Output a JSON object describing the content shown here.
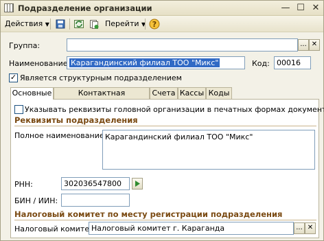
{
  "window": {
    "title": "Подразделение организации",
    "app_icon": "grid-icon",
    "controls": [
      "minimize-icon",
      "maximize-icon",
      "close-icon"
    ]
  },
  "toolbar": {
    "actions_label": "Действия",
    "goto_label": "Перейти",
    "icons": [
      "save-icon",
      "refresh-icon",
      "copy-icon",
      "help-icon"
    ]
  },
  "form": {
    "group_label": "Группа:",
    "group_value": "",
    "name_label": "Наименование:",
    "name_value": "Карагандинский филиал ТОО \"Микс\"",
    "code_label": "Код:",
    "code_value": "00016",
    "structural_label": "Является структурным подразделением",
    "structural_checked": true
  },
  "tabs": [
    "Основные",
    "Контактная информация",
    "Счета",
    "Кассы",
    "Коды"
  ],
  "main": {
    "head_org_label": "Указывать реквизиты головной организации в печатных формах документов",
    "head_org_checked": false,
    "section1_title": "Реквизиты подразделения",
    "full_name_label": "Полное наименование:",
    "full_name_value": "Карагандинский филиал ТОО \"Микс\"",
    "rnn_label": "РНН:",
    "rnn_value": "302036547800",
    "bin_label": "БИН / ИИН:",
    "bin_value": "",
    "section2_title": "Налоговый комитет по месту регистрации подразделения",
    "tax_label": "Налоговый комитет:",
    "tax_value": "Налоговый комитет г. Караганда"
  }
}
